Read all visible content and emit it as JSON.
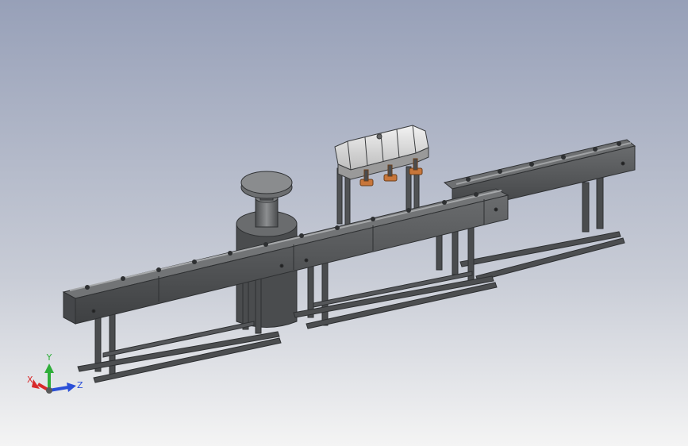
{
  "viewport": {
    "background_top": "#97a0b8",
    "background_bottom": "#f4f4f4",
    "model_color": "#57595b",
    "model_dark": "#3a3c3e",
    "model_light": "#8a8c8e",
    "hopper_color": "#e4e4e4",
    "nozzle_color": "#c8763a"
  },
  "triad": {
    "x_label": "X",
    "y_label": "Y",
    "z_label": "Z",
    "x_color": "#d8282a",
    "y_color": "#2fae3a",
    "z_color": "#2a4fd8"
  }
}
